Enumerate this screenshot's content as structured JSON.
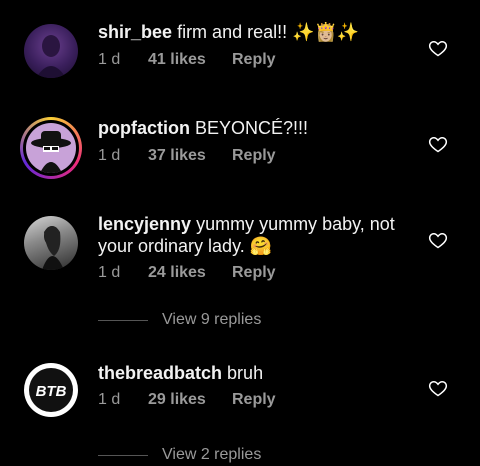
{
  "comments": [
    {
      "username": "shir_bee",
      "text": "firm and real!! ✨👸🏼✨",
      "time": "1 d",
      "likes": "41 likes",
      "reply_label": "Reply",
      "avatar_icon": "profile-photo"
    },
    {
      "username": "popfaction",
      "text": "BEYONCÉ?!!!",
      "time": "1 d",
      "likes": "37 likes",
      "reply_label": "Reply",
      "avatar_icon": "wide-brim-hat-logo"
    },
    {
      "username": "lencyjenny",
      "text": "yummy yummy baby, not your ordinary lady. 🤗",
      "time": "1 d",
      "likes": "24 likes",
      "reply_label": "Reply",
      "avatar_icon": "profile-photo",
      "view_replies": "View 9 replies"
    },
    {
      "username": "thebreadbatch",
      "text": "bruh",
      "time": "1 d",
      "likes": "29 likes",
      "reply_label": "Reply",
      "avatar_icon": "btb-logo",
      "view_replies": "View 2 replies",
      "avatar_text": "BTB"
    }
  ],
  "colors": {
    "background": "#000000",
    "meta_text": "#9a9a9a",
    "story_ring": [
      "#f9ce34",
      "#ee2a7b",
      "#6228d7"
    ]
  }
}
